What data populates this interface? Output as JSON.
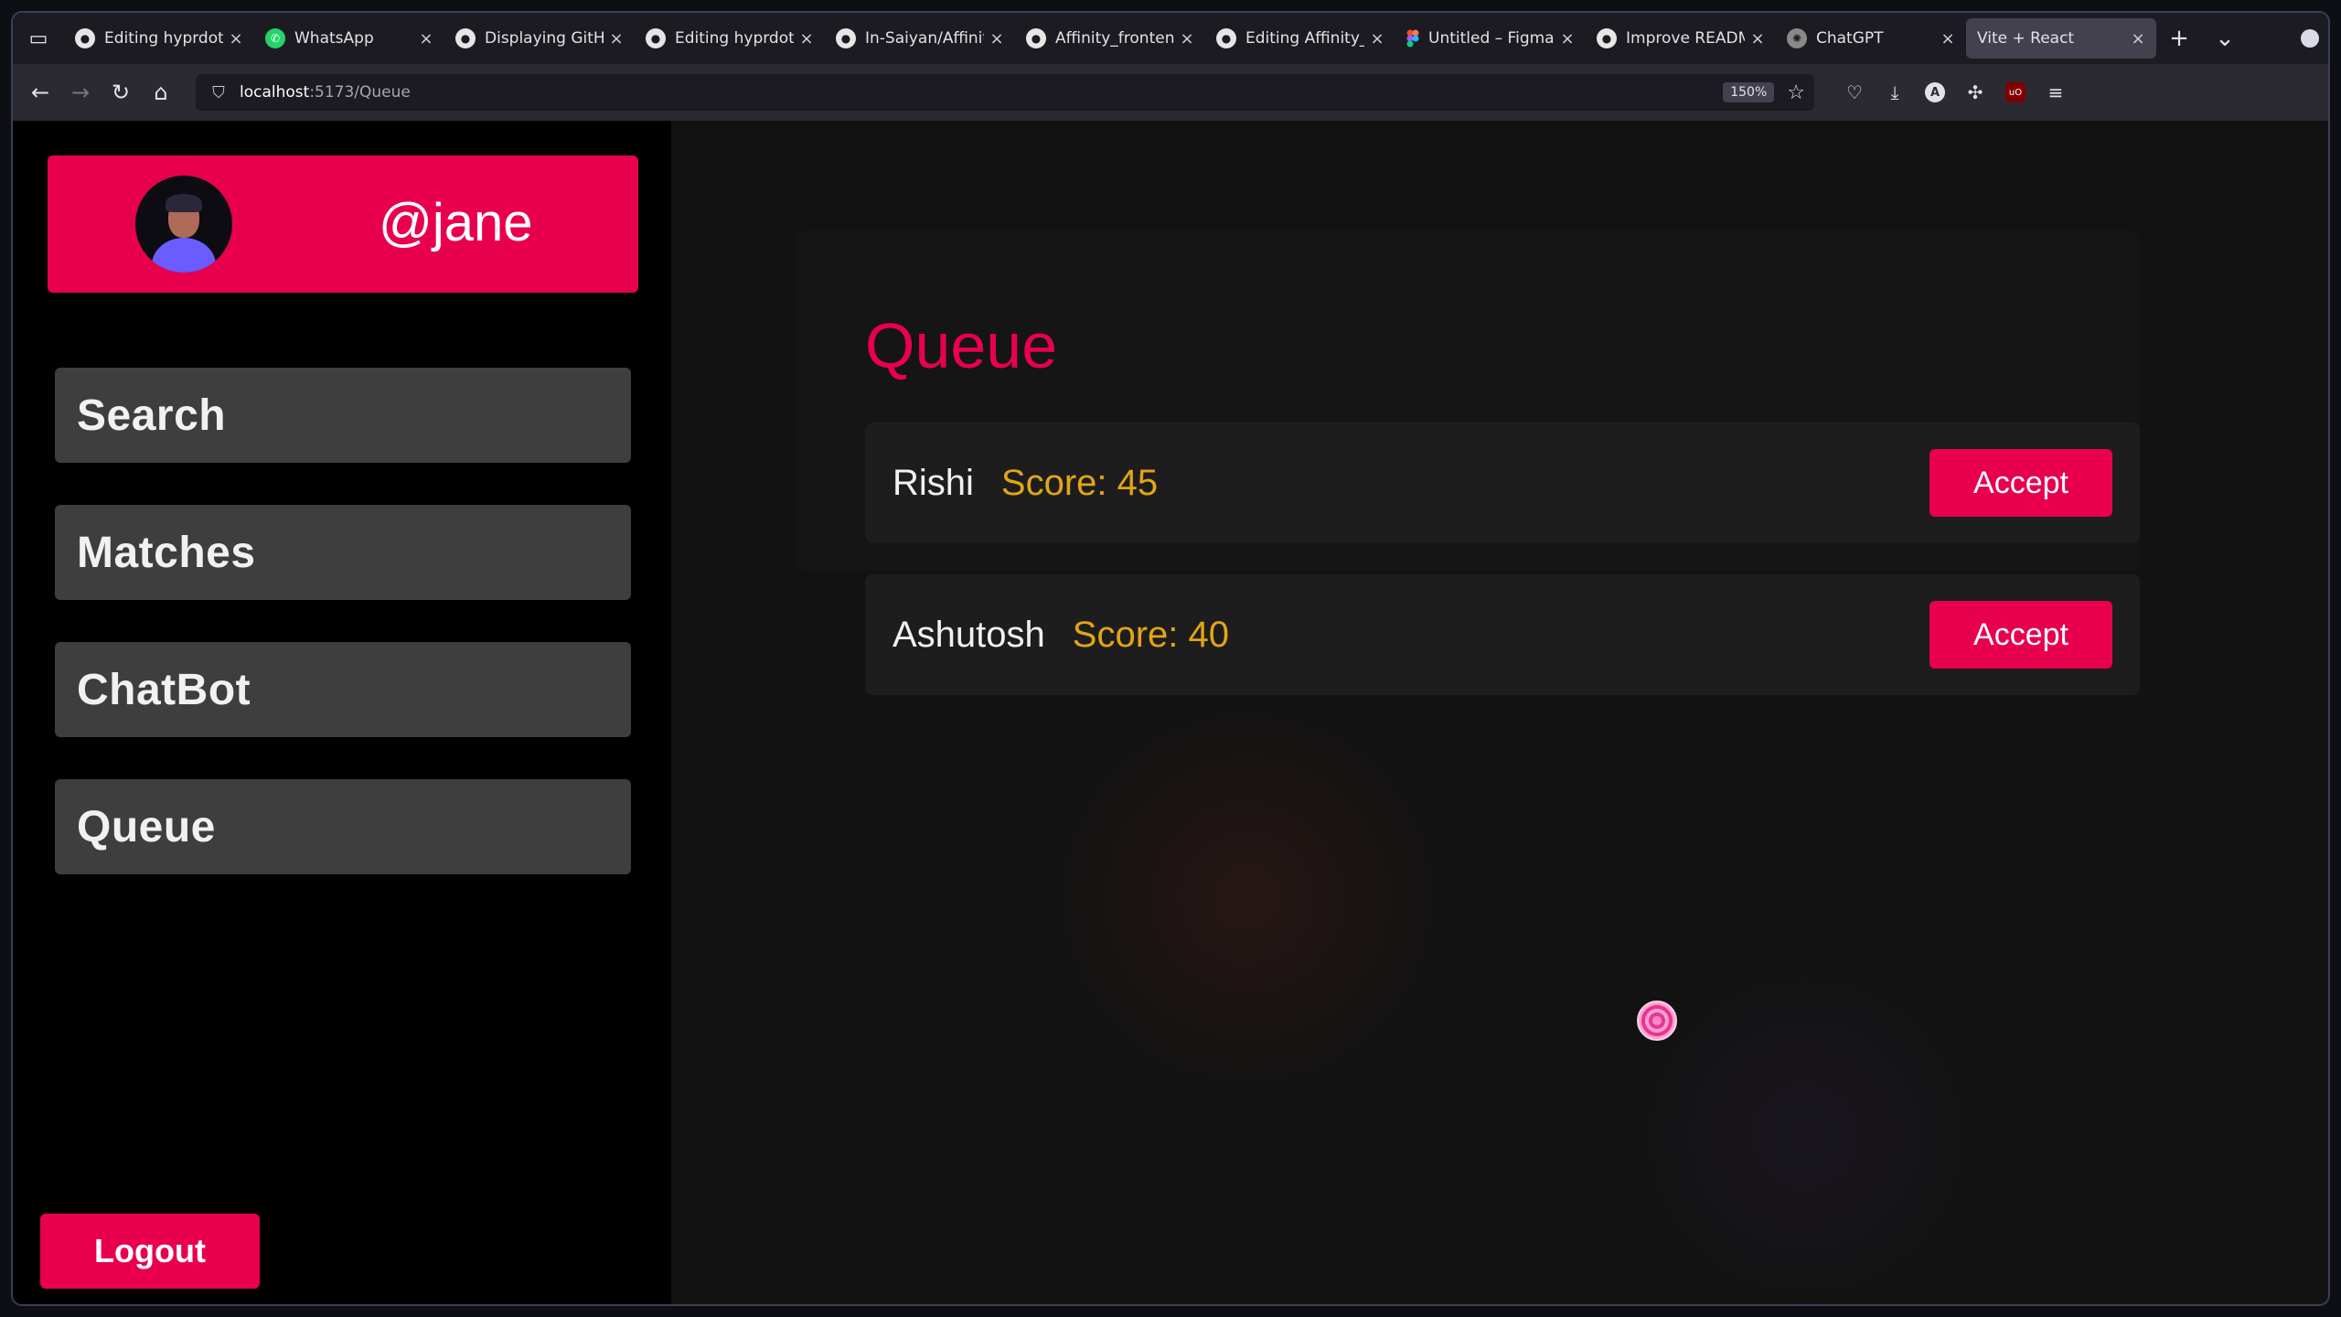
{
  "browser": {
    "tabs": [
      {
        "title": "Editing hyprdots/R",
        "favicon": "github-icon",
        "active": false
      },
      {
        "title": "WhatsApp",
        "favicon": "whatsapp-icon",
        "active": false
      },
      {
        "title": "Displaying GitHub",
        "favicon": "github-icon",
        "active": false
      },
      {
        "title": "Editing hyprdots/R",
        "favicon": "github-icon",
        "active": false
      },
      {
        "title": "In-Saiyan/Affinity_",
        "favicon": "github-icon",
        "active": false
      },
      {
        "title": "Affinity_frontend/",
        "favicon": "github-icon",
        "active": false
      },
      {
        "title": "Editing Affinity_fr",
        "favicon": "github-icon",
        "active": false
      },
      {
        "title": "Untitled – Figma",
        "favicon": "figma-icon",
        "active": false
      },
      {
        "title": "Improve README",
        "favicon": "github-icon",
        "active": false
      },
      {
        "title": "ChatGPT",
        "favicon": "chatgpt-icon",
        "active": false
      },
      {
        "title": "Vite + React",
        "favicon": "",
        "active": true
      }
    ],
    "url_host": "localhost",
    "url_path": ":5173/Queue",
    "zoom": "150%"
  },
  "sidebar": {
    "username": "@jane",
    "nav": [
      {
        "label": "Search"
      },
      {
        "label": "Matches"
      },
      {
        "label": "ChatBot"
      },
      {
        "label": "Queue"
      }
    ],
    "logout_label": "Logout"
  },
  "main": {
    "title": "Queue",
    "queue": [
      {
        "name": "Rishi",
        "score": "Score: 45",
        "action": "Accept"
      },
      {
        "name": "Ashutosh",
        "score": "Score: 40",
        "action": "Accept"
      }
    ]
  },
  "colors": {
    "accent": "#e8004f",
    "score": "#e2a516",
    "nav_item_bg": "#3e3e3e"
  }
}
